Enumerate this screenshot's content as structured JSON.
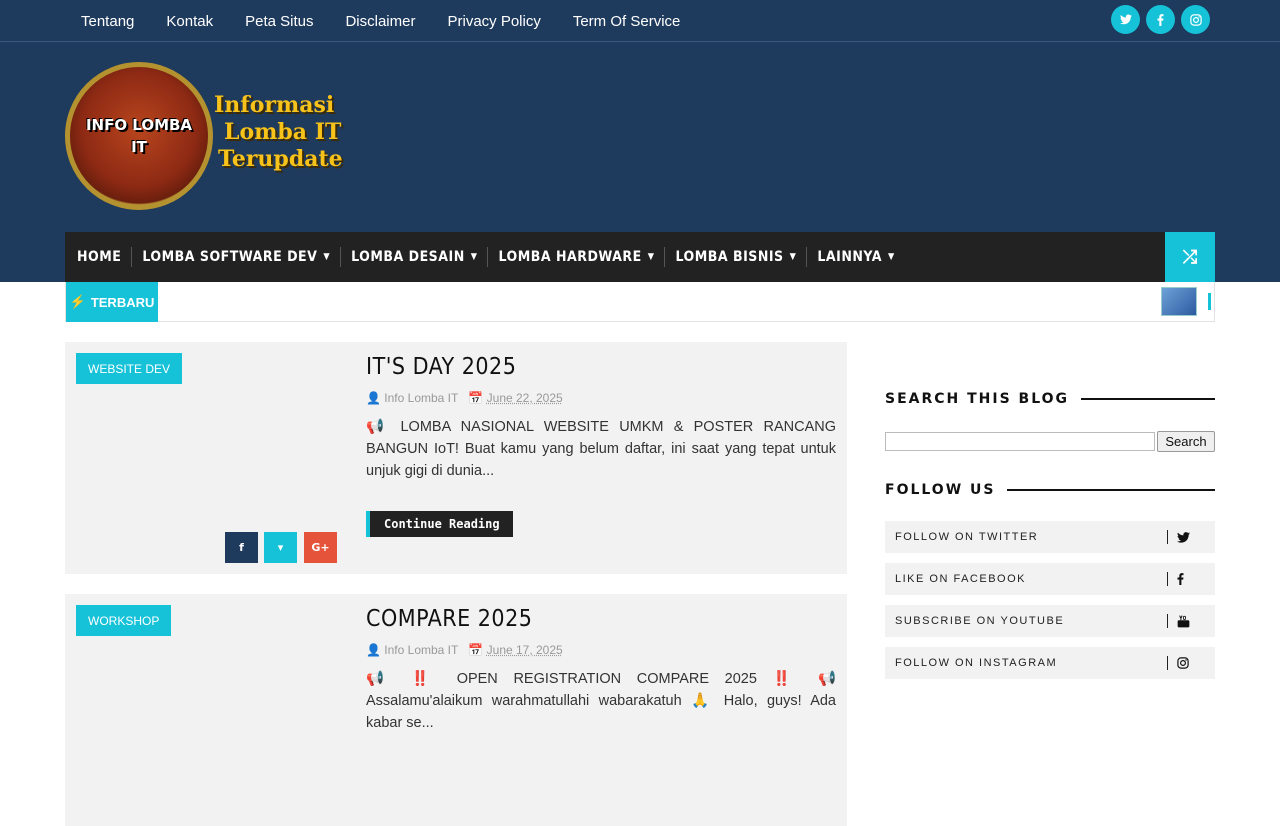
{
  "topbar": {
    "links": [
      "Tentang",
      "Kontak",
      "Peta Situs",
      "Disclaimer",
      "Privacy Policy",
      "Term Of Service"
    ],
    "social_icons": [
      "twitter-icon",
      "facebook-icon",
      "instagram-icon"
    ]
  },
  "logo": {
    "badge_line1": "INFO LOMBA",
    "badge_line2": "IT",
    "tagline_line1": "Informasi",
    "tagline_line2": "Lomba IT",
    "tagline_line3": "Terupdate"
  },
  "nav": {
    "items": [
      "HOME",
      "LOMBA SOFTWARE DEV",
      "LOMBA DESAIN",
      "LOMBA HARDWARE",
      "LOMBA BISNIS",
      "LAINNYA"
    ]
  },
  "ticker": {
    "label": "TERBARU"
  },
  "posts": [
    {
      "category": "WEBSITE DEV",
      "title": "IT'S DAY 2025",
      "author": "Info Lomba IT",
      "date": "June 22, 2025",
      "excerpt": "📢 LOMBA NASIONAL WEBSITE UMKM & POSTER RANCANG BANGUN IoT! Buat kamu yang belum daftar, ini saat yang tepat untuk unjuk gigi di dunia...",
      "button": "Continue Reading"
    },
    {
      "category": "WORKSHOP",
      "title": "COMPARE 2025",
      "author": "Info Lomba IT",
      "date": "June 17, 2025",
      "excerpt": "📢 ‼️ OPEN REGISTRATION COMPARE 2025 ‼️ 📢 Assalamu'alaikum warahmatullahi wabarakatuh 🙏 Halo, guys! Ada kabar se..."
    }
  ],
  "sidebar": {
    "search_title": "SEARCH THIS BLOG",
    "search_button": "Search",
    "follow_title": "FOLLOW US",
    "follow_items": [
      {
        "label": "FOLLOW ON TWITTER",
        "icon": "twitter-icon"
      },
      {
        "label": "LIKE ON FACEBOOK",
        "icon": "facebook-icon"
      },
      {
        "label": "SUBSCRIBE ON YOUTUBE",
        "icon": "youtube-icon"
      },
      {
        "label": "FOLLOW ON INSTAGRAM",
        "icon": "instagram-icon"
      }
    ]
  },
  "colors": {
    "header_bg": "#1e3a5c",
    "accent": "#16c2d8",
    "nav_bg": "#222222",
    "facebook": "#1e3a5c",
    "googleplus": "#e4533a"
  }
}
